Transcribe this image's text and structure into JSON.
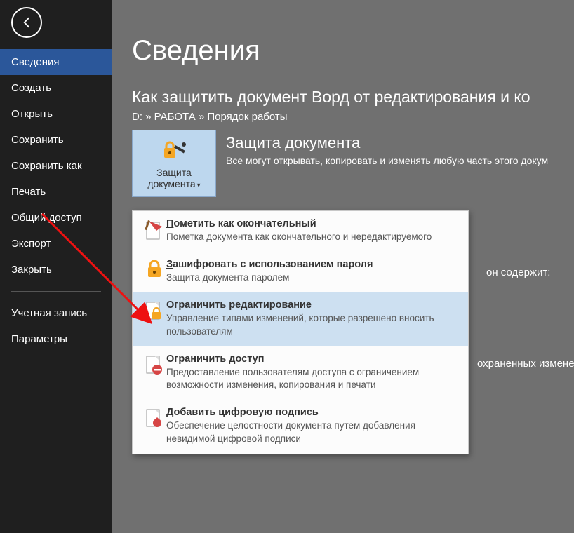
{
  "sidebar": {
    "items": [
      {
        "label": "Сведения",
        "active": true
      },
      {
        "label": "Создать"
      },
      {
        "label": "Открыть"
      },
      {
        "label": "Сохранить"
      },
      {
        "label": "Сохранить как"
      },
      {
        "label": "Печать"
      },
      {
        "label": "Общий доступ"
      },
      {
        "label": "Экспорт"
      },
      {
        "label": "Закрыть"
      }
    ],
    "footer_items": [
      {
        "label": "Учетная запись"
      },
      {
        "label": "Параметры"
      }
    ]
  },
  "page": {
    "heading": "Сведения",
    "doc_title": "Как защитить документ Ворд от редактирования и ко",
    "path": "D: » РАБОТА » Порядок работы"
  },
  "protect": {
    "button_line1": "Защита",
    "button_line2": "документа",
    "section_title": "Защита документа",
    "section_desc": "Все могут открывать, копировать и изменять любую часть этого докум"
  },
  "notes": {
    "contains": "он содержит:",
    "unsaved": "охраненных измене"
  },
  "menu": {
    "items": [
      {
        "title_ul": "П",
        "title_rest": "ометить как окончательный",
        "desc": "Пометка документа как окончательного и нередактируемого",
        "icon": "final"
      },
      {
        "title_ul": "З",
        "title_rest": "ашифровать с использованием пароля",
        "desc": "Защита документа паролем",
        "icon": "encrypt"
      },
      {
        "title_ul": "О",
        "title_rest": "граничить редактирование",
        "desc": "Управление типами изменений, которые разрешено вносить пользователям",
        "icon": "restrict-edit",
        "hover": true
      },
      {
        "title_ul": "О",
        "title_rest": "граничить доступ",
        "desc": "Предоставление пользователям доступа с ограничением возможности изменения, копирования и печати",
        "icon": "restrict-access"
      },
      {
        "title_ul": "Д",
        "title_rest": "обавить цифровую подпись",
        "desc": "Обеспечение целостности документа путем добавления невидимой цифровой подписи",
        "icon": "signature"
      }
    ]
  },
  "colors": {
    "accent": "#2b579a",
    "highlight": "#bdd7ee"
  }
}
